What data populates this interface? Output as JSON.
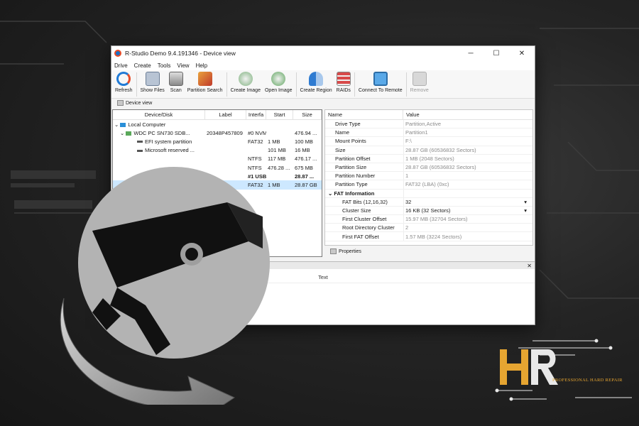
{
  "window": {
    "title": "R-Studio Demo 9.4.191346 - Device view",
    "controls": {
      "minimize": "─",
      "maximize": "☐",
      "close": "✕"
    }
  },
  "menu": [
    "Drive",
    "Create",
    "Tools",
    "View",
    "Help"
  ],
  "toolbar": [
    {
      "label": "Refresh",
      "icon": "refresh-icon",
      "enabled": true
    },
    {
      "label": "Show Files",
      "icon": "show-files-icon",
      "enabled": true
    },
    {
      "label": "Scan",
      "icon": "scan-icon",
      "enabled": true
    },
    {
      "label": "Partition Search",
      "icon": "partition-search-icon",
      "enabled": true
    },
    {
      "label": "Create Image",
      "icon": "create-image-icon",
      "enabled": true
    },
    {
      "label": "Open Image",
      "icon": "open-image-icon",
      "enabled": true
    },
    {
      "label": "Create Region",
      "icon": "create-region-icon",
      "enabled": true
    },
    {
      "label": "RAIDs",
      "icon": "raids-icon",
      "enabled": true
    },
    {
      "label": "Connect To Remote",
      "icon": "connect-remote-icon",
      "enabled": true
    },
    {
      "label": "Remove",
      "icon": "remove-icon",
      "enabled": false
    }
  ],
  "tab": {
    "label": "Device view"
  },
  "device_table": {
    "headers": [
      "Device/Disk",
      "Label",
      "Interfa",
      "Start",
      "Size"
    ],
    "rows": [
      {
        "name": "Local Computer",
        "label": "",
        "iface": "",
        "start": "",
        "size": ""
      },
      {
        "name": "WDC PC SN730 SDB...",
        "label": "20348P457809",
        "iface": "#0 NVME, SSD",
        "start": "",
        "size": "476.94 ..."
      },
      {
        "name": "EFI system partition",
        "label": "",
        "iface": "FAT32",
        "start": "1 MB",
        "size": "100 MB"
      },
      {
        "name": "Microsoft reserved ...",
        "label": "",
        "iface": "",
        "start": "101 MB",
        "size": "16 MB"
      },
      {
        "name": "",
        "label": "",
        "iface": "NTFS",
        "start": "117 MB",
        "size": "476.17 ..."
      },
      {
        "name": "",
        "label": "",
        "iface": "NTFS",
        "start": "476.28 ...",
        "size": "675 MB"
      },
      {
        "name": "",
        "label": "20...",
        "iface": "#1 USB",
        "start": "",
        "size": "28.87 ..."
      },
      {
        "name": "",
        "label": "",
        "iface": "FAT32",
        "start": "1 MB",
        "size": "28.87 GB"
      }
    ]
  },
  "properties": {
    "headers": [
      "Name",
      "Value"
    ],
    "rows": [
      {
        "name": "Drive Type",
        "value": "Partition,Active"
      },
      {
        "name": "Name",
        "value": "Partition1"
      },
      {
        "name": "Mount Points",
        "value": "F:\\"
      },
      {
        "name": "Size",
        "value": "28.87 GB (60536832 Sectors)"
      },
      {
        "name": "Partition Offset",
        "value": "1 MB (2048 Sectors)"
      },
      {
        "name": "Partition Size",
        "value": "28.87 GB (60536832 Sectors)"
      },
      {
        "name": "Partition Number",
        "value": "1"
      },
      {
        "name": "Partition Type",
        "value": "FAT32 (LBA) (0xc)"
      }
    ],
    "group": "FAT Information",
    "group_rows": [
      {
        "name": "FAT Bits (12,16,32)",
        "value": "32"
      },
      {
        "name": "Cluster Size",
        "value": "16 KB (32 Sectors)"
      },
      {
        "name": "First Cluster Offset",
        "value": "15.97 MB (32704 Sectors)"
      },
      {
        "name": "Root Directory Cluster",
        "value": "2"
      },
      {
        "name": "First FAT Offset",
        "value": "1.57 MB (3224 Sectors)"
      }
    ],
    "tab_label": "Properties"
  },
  "log": {
    "header": "Text",
    "close": "✕"
  },
  "logo": {
    "tagline": "PROFESSIONAL HARD REPAIR",
    "brand_color": "#e6a531"
  }
}
